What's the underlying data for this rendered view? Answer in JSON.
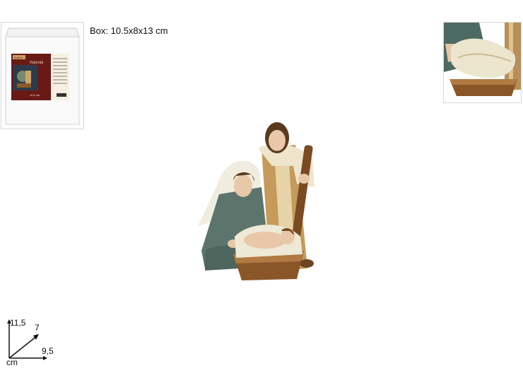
{
  "box_thumbnail": {
    "brand": "Bollina",
    "product_name": "Natività",
    "size_tag": "10,5 cm"
  },
  "box_dimensions_label": "Box: 10.5x8x13 cm",
  "product_dimensions": {
    "height": "11,5",
    "depth": "7",
    "width": "9,5",
    "unit": "cm"
  }
}
